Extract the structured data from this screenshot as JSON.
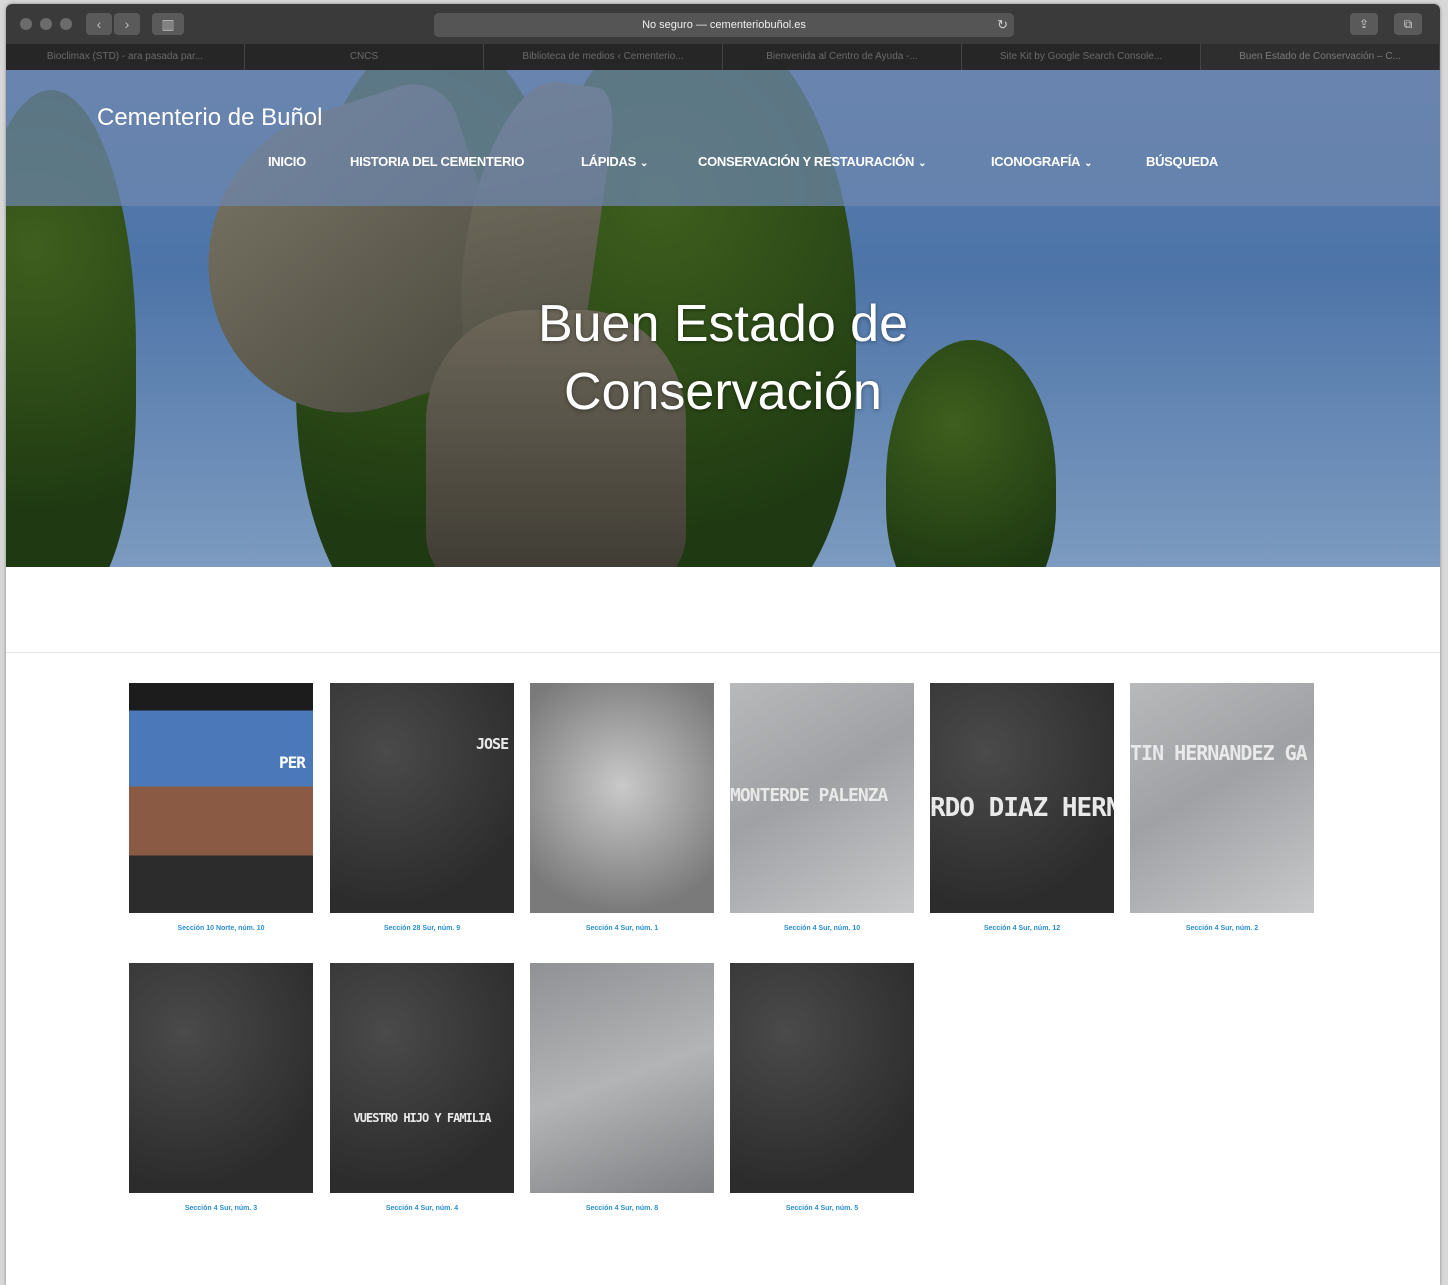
{
  "browser": {
    "url": "No seguro — cementeriobuñol.es",
    "tabs": [
      "Bioclimax (STD) - ara pasada par...",
      "CNCS",
      "Biblioteca de medios ‹ Cementerio...",
      "Bienvenida al Centro de Ayuda -...",
      "Site Kit by Google Search Console...",
      "Buen Estado de Conservación – C..."
    ],
    "active_tab_index": 5
  },
  "site": {
    "brand": "Cementerio de Buñol",
    "menu": [
      {
        "label": "INICIO",
        "has_dropdown": false
      },
      {
        "label": "HISTORIA DEL CEMENTERIO",
        "has_dropdown": false
      },
      {
        "label": "LÁPIDAS",
        "has_dropdown": true
      },
      {
        "label": "CONSERVACIÓN Y RESTAURACIÓN",
        "has_dropdown": true
      },
      {
        "label": "ICONOGRAFÍA",
        "has_dropdown": true
      },
      {
        "label": "BÚSQUEDA",
        "has_dropdown": false
      }
    ]
  },
  "hero": {
    "title_line1": "Buen Estado de",
    "title_line2": "Conservación"
  },
  "gallery": [
    {
      "caption": "Sección 10 Norte, núm. 10",
      "text": "PER"
    },
    {
      "caption": "Sección 28 Sur, núm. 9",
      "text": "JOSE"
    },
    {
      "caption": "Sección 4 Sur, núm. 1",
      "text": ""
    },
    {
      "caption": "Sección 4 Sur, núm. 10",
      "text": "MONTERDE PALENZA"
    },
    {
      "caption": "Sección 4 Sur, núm. 12",
      "text": "RDO DIAZ HERNA"
    },
    {
      "caption": "Sección 4 Sur, núm. 2",
      "text": "TIN HERNANDEZ GA"
    },
    {
      "caption": "Sección 4 Sur, núm. 3",
      "text": ""
    },
    {
      "caption": "Sección 4 Sur, núm. 4",
      "text": "VUESTRO HIJO Y FAMILIA"
    },
    {
      "caption": "Sección 4 Sur, núm. 8",
      "text": ""
    },
    {
      "caption": "Sección 4 Sur, núm. 5",
      "text": ""
    }
  ],
  "colors": {
    "link": "#2a8fd0",
    "nav_overlay": "#6e87af"
  }
}
